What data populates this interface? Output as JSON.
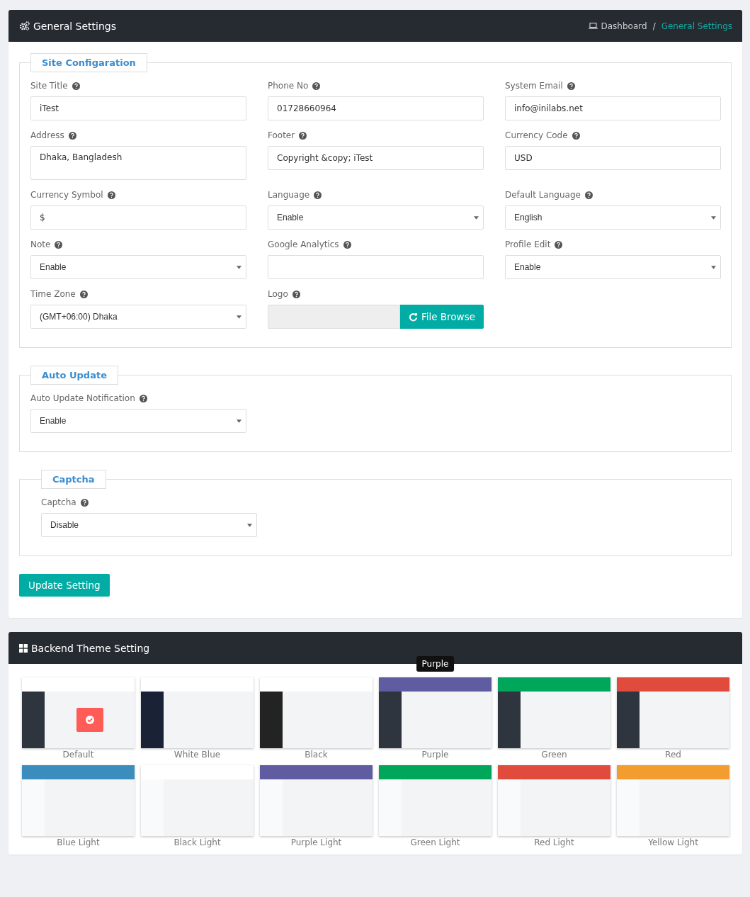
{
  "settings_panel": {
    "title": "General Settings",
    "breadcrumb_separator": "/",
    "breadcrumb": [
      {
        "label": "Dashboard",
        "current": false
      },
      {
        "label": "General Settings",
        "current": true
      }
    ],
    "sections": [
      {
        "legend": "Site Configaration",
        "indented": false,
        "fields": [
          {
            "label": "Site Title",
            "kind": "text",
            "value": "iTest"
          },
          {
            "label": "Phone No",
            "kind": "text",
            "value": "01728660964"
          },
          {
            "label": "System Email",
            "kind": "text",
            "value": "info@inilabs.net"
          },
          {
            "label": "Address",
            "kind": "textarea",
            "value": "Dhaka, Bangladesh"
          },
          {
            "label": "Footer",
            "kind": "text",
            "value": "Copyright &copy; iTest"
          },
          {
            "label": "Currency Code",
            "kind": "text",
            "value": "USD"
          },
          {
            "label": "Currency Symbol",
            "kind": "text",
            "value": "$"
          },
          {
            "label": "Language",
            "kind": "select",
            "value": "Enable"
          },
          {
            "label": "Default Language",
            "kind": "select",
            "value": "English"
          },
          {
            "label": "Note",
            "kind": "select",
            "value": "Enable"
          },
          {
            "label": "Google Analytics",
            "kind": "text"
          },
          {
            "label": "Profile Edit",
            "kind": "select",
            "value": "Enable"
          },
          {
            "label": "Time Zone",
            "kind": "select",
            "value": "(GMT+06:00) Dhaka"
          },
          {
            "label": "Logo",
            "kind": "file",
            "button": "File Browse"
          }
        ]
      },
      {
        "legend": "Auto Update",
        "indented": false,
        "fields": [
          {
            "label": "Auto Update Notification",
            "kind": "select",
            "value": "Enable"
          }
        ]
      },
      {
        "legend": "Captcha",
        "indented": true,
        "fields": [
          {
            "label": "Captcha",
            "kind": "select",
            "value": "Disable"
          }
        ]
      }
    ],
    "submit": "Update Setting"
  },
  "theme_panel": {
    "title": "Backend Theme Setting",
    "themes": [
      {
        "name": "Default",
        "kind": "dark",
        "selected": true,
        "color": "#ffffff"
      },
      {
        "name": "White Blue",
        "kind": "navy",
        "selected": false,
        "color": "#ffffff"
      },
      {
        "name": "Black",
        "kind": "black",
        "selected": false,
        "color": "#ffffff"
      },
      {
        "name": "Purple",
        "kind": "dark",
        "selected": false,
        "color": "#605ca1",
        "tooltip": "Purple"
      },
      {
        "name": "Green",
        "kind": "dark",
        "selected": false,
        "color": "#00a65a"
      },
      {
        "name": "Red",
        "kind": "dark",
        "selected": false,
        "color": "#e04b3e"
      },
      {
        "name": "Blue Light",
        "kind": "light",
        "selected": false,
        "color": "#3b8dbd"
      },
      {
        "name": "Black Light",
        "kind": "light",
        "selected": false,
        "color": "#ffffff"
      },
      {
        "name": "Purple Light",
        "kind": "light",
        "selected": false,
        "color": "#605ca1"
      },
      {
        "name": "Green Light",
        "kind": "light",
        "selected": false,
        "color": "#00a65a"
      },
      {
        "name": "Red Light",
        "kind": "light",
        "selected": false,
        "color": "#e04b3e"
      },
      {
        "name": "Yellow Light",
        "kind": "light",
        "selected": false,
        "color": "#f39c2f"
      }
    ]
  }
}
